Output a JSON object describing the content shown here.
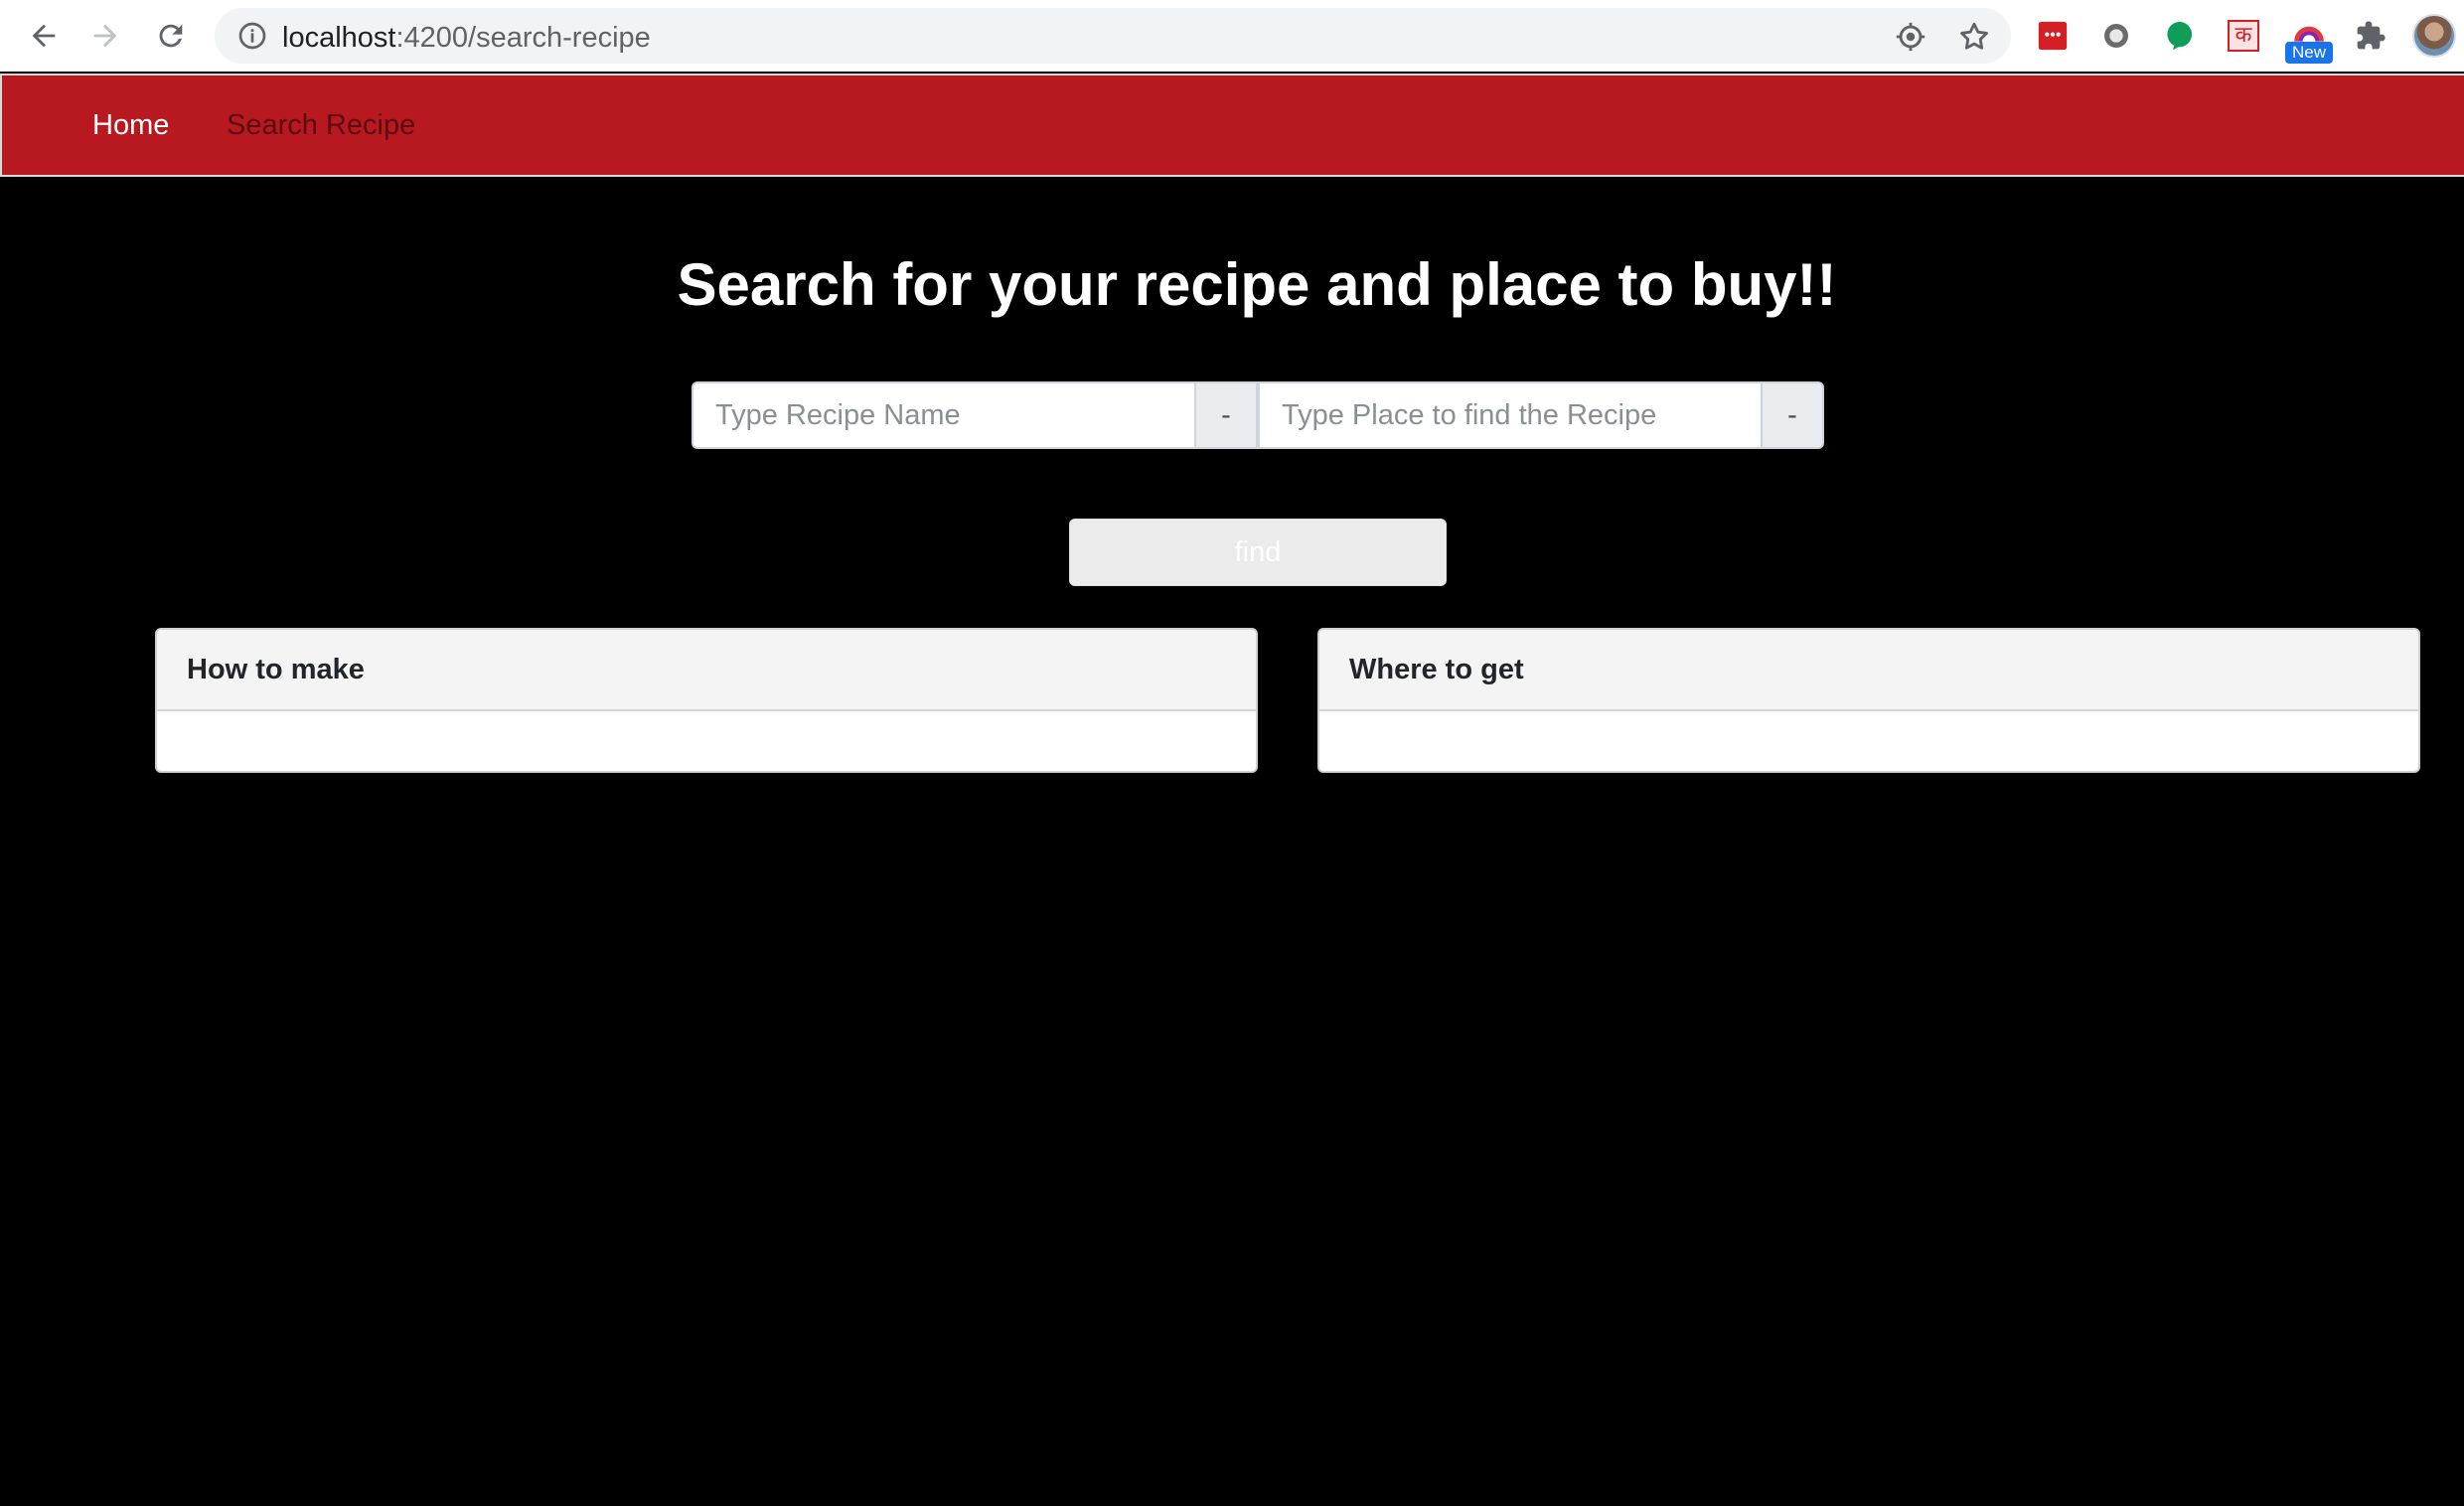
{
  "browser": {
    "url_host": "localhost",
    "url_path": ":4200/search-recipe",
    "new_badge": "New",
    "extension_text": "क"
  },
  "navbar": {
    "home": "Home",
    "search_recipe": "Search Recipe",
    "accent_color": "#b8181f"
  },
  "main": {
    "title": "Search for your recipe and place to buy!!",
    "recipe_input": {
      "placeholder": "Type Recipe Name",
      "value": ""
    },
    "recipe_addon": "-",
    "place_input": {
      "placeholder": "Type Place to find the Recipe",
      "value": ""
    },
    "place_addon": "-",
    "find_label": "find"
  },
  "cards": {
    "how_to_make": "How to make",
    "where_to_get": "Where to get"
  }
}
